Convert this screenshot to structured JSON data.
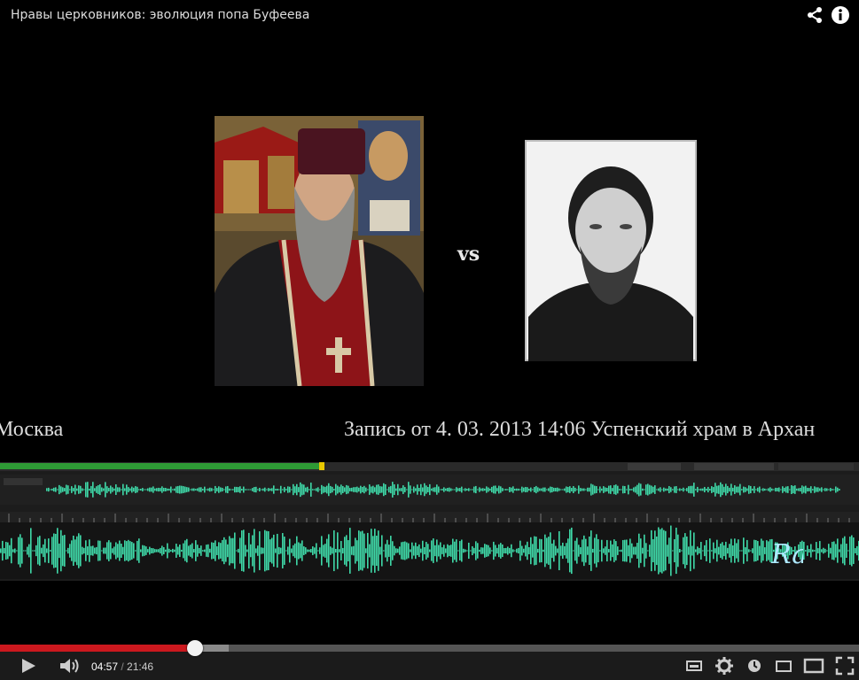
{
  "window": {
    "title": "Нравы церковников: эволюция попа Буфеева"
  },
  "video": {
    "vs_text": "vs",
    "caption_left": "Москва",
    "caption_right": "Запись от 4. 03. 2013 14:06  Успенский храм в Архан",
    "logo_text": "Ra"
  },
  "player": {
    "current_time": "04:57",
    "separator": " / ",
    "duration": "21:46",
    "progress": 0.227,
    "buffered": 0.266
  },
  "icons": {
    "share": "share-icon",
    "info": "info-icon",
    "play": "play-icon",
    "volume": "volume-icon",
    "captions": "captions-icon",
    "settings": "gear-icon",
    "watch_later": "watch-later-icon",
    "small_player": "small-player-icon",
    "large_player": "large-player-icon",
    "fullscreen": "fullscreen-icon"
  },
  "colors": {
    "progress_red": "#cc181e",
    "waveform": "#3fd9a8",
    "background": "#000000"
  }
}
